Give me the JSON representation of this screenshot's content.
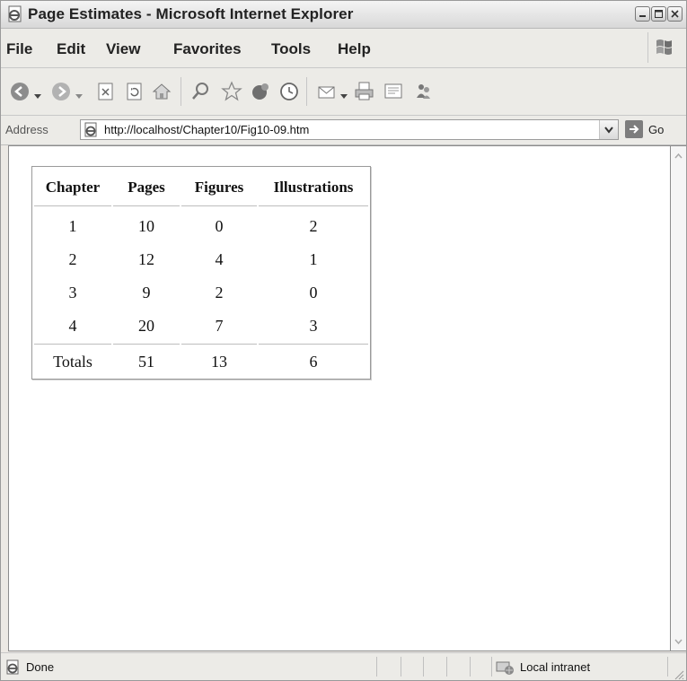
{
  "window": {
    "title": "Page Estimates - Microsoft Internet Explorer"
  },
  "menu": {
    "items": [
      "File",
      "Edit",
      "View",
      "Favorites",
      "Tools",
      "Help"
    ]
  },
  "toolbar": {
    "buttons": [
      "back-icon",
      "forward-icon",
      "stop-icon",
      "refresh-icon",
      "home-icon",
      "search-icon",
      "favorites-icon",
      "media-icon",
      "history-icon",
      "mail-icon",
      "print-icon",
      "edit-icon",
      "messenger-icon"
    ]
  },
  "address": {
    "label": "Address",
    "url": "http://localhost/Chapter10/Fig10-09.htm",
    "go_label": "Go"
  },
  "table": {
    "headers": [
      "Chapter",
      "Pages",
      "Figures",
      "Illustrations"
    ],
    "rows": [
      [
        "1",
        "10",
        "0",
        "2"
      ],
      [
        "2",
        "12",
        "4",
        "1"
      ],
      [
        "3",
        "9",
        "2",
        "0"
      ],
      [
        "4",
        "20",
        "7",
        "3"
      ]
    ],
    "footer": [
      "Totals",
      "51",
      "13",
      "6"
    ]
  },
  "status": {
    "text": "Done",
    "zone": "Local intranet"
  },
  "colors": {
    "chrome": "#ecebe7",
    "content_bg": "#ffffff",
    "border": "#9a9a9a"
  }
}
